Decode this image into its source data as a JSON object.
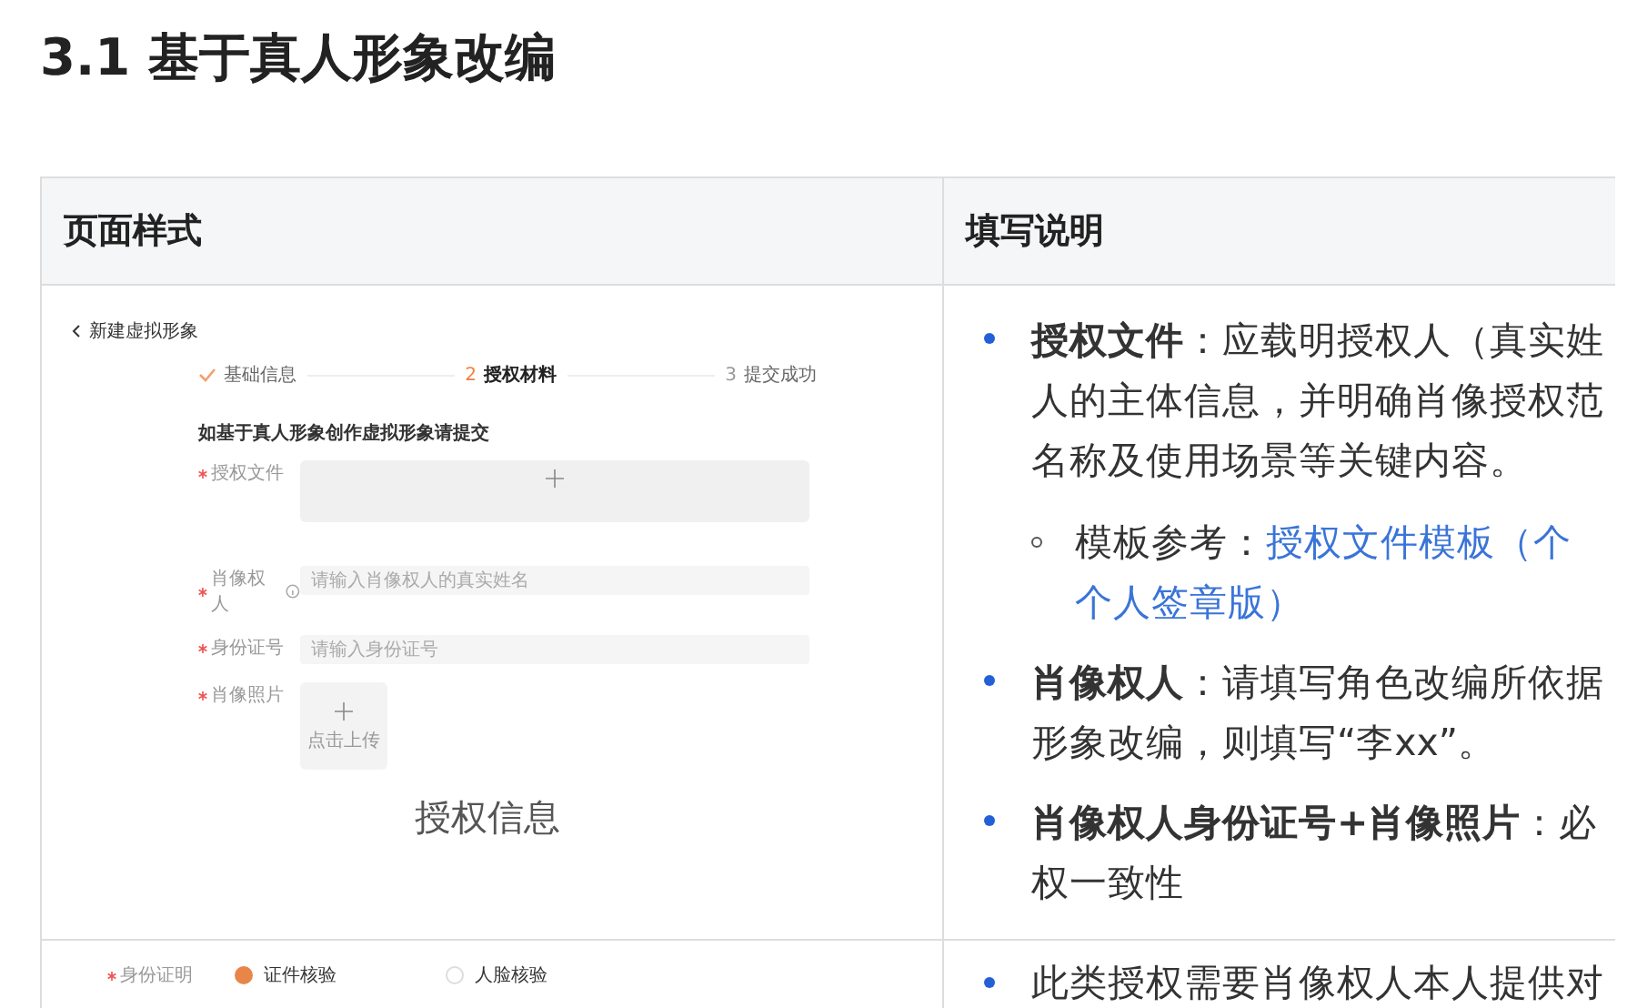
{
  "title": "3.1 基于真人形象改编",
  "table": {
    "columns": [
      "页面样式",
      "填写说明"
    ],
    "rows": [
      {
        "form": {
          "back_label": "新建虚拟形象",
          "steps": [
            {
              "label": "基础信息",
              "completed": true,
              "selected": false
            },
            {
              "number": "2",
              "label": "授权材料",
              "completed": false,
              "selected": true
            },
            {
              "number": "3",
              "label": "提交成功",
              "completed": false,
              "selected": false
            }
          ],
          "section_title": "如基于真人形象创作虚拟形象请提交",
          "fields": [
            {
              "kind": "upload-wide",
              "label": "授权文件",
              "required": true
            },
            {
              "kind": "input",
              "label": "肖像权人",
              "required": true,
              "info": true,
              "placeholder": "请输入肖像权人的真实姓名"
            },
            {
              "kind": "input",
              "label": "身份证号",
              "required": true,
              "info": false,
              "placeholder": "请输入身份证号"
            },
            {
              "kind": "upload",
              "label": "肖像照片",
              "required": true,
              "button": "点击上传"
            }
          ],
          "caption": "授权信息"
        },
        "notes": [
          {
            "lines": [
              "**授权文件**：应载明授权人（真实姓",
              "人的主体信息，并明确肖像授权范",
              "名称及使用场景等关键内容。"
            ],
            "sub": [
              {
                "prefix": "模板参考：",
                "link_lines": [
                  "授权文件模板（个",
                  "个人签章版）"
                ]
              }
            ]
          },
          {
            "lines": [
              "**肖像权人**：请填写角色改编所依据",
              "形象改编，则填写“李xx”。"
            ]
          },
          {
            "lines": [
              "**肖像权人身份证号+肖像照片**：必",
              "权一致性"
            ]
          }
        ]
      },
      {
        "form": {
          "fields": [
            {
              "kind": "radio",
              "label": "身份证明",
              "required": true,
              "options": [
                {
                  "label": "证件核验",
                  "selected": true
                },
                {
                  "label": "人脸核验",
                  "selected": false
                }
              ]
            }
          ]
        },
        "notes": [
          {
            "lines": [
              "此类授权需要肖像权人本人提供对"
            ]
          }
        ]
      }
    ]
  }
}
